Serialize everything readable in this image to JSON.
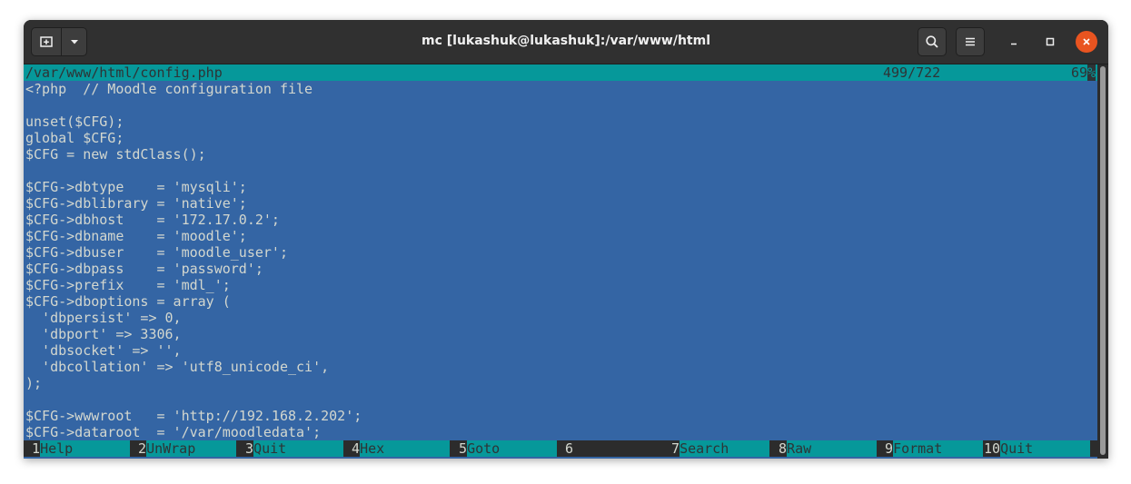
{
  "window": {
    "title": "mc [lukashuk@lukashuk]:/var/www/html"
  },
  "icons": {
    "new_tab": "new-tab-icon",
    "menu_dropdown": "chevron-down-icon",
    "search": "search-icon",
    "hamburger": "hamburger-menu-icon",
    "minimize": "minimize-icon",
    "maximize": "maximize-icon",
    "close": "close-icon"
  },
  "colors": {
    "terminal_bg": "#3465a4",
    "status_bg": "#06989a",
    "close_button": "#e95420"
  },
  "viewer": {
    "filepath": "/var/www/html/config.php",
    "line_position": "499/722",
    "percent": "69",
    "percent_sign": "%"
  },
  "code_lines": [
    "<?php  // Moodle configuration file",
    "",
    "unset($CFG);",
    "global $CFG;",
    "$CFG = new stdClass();",
    "",
    "$CFG->dbtype    = 'mysqli';",
    "$CFG->dblibrary = 'native';",
    "$CFG->dbhost    = '172.17.0.2';",
    "$CFG->dbname    = 'moodle';",
    "$CFG->dbuser    = 'moodle_user';",
    "$CFG->dbpass    = 'password';",
    "$CFG->prefix    = 'mdl_';",
    "$CFG->dboptions = array (",
    "  'dbpersist' => 0,",
    "  'dbport' => 3306,",
    "  'dbsocket' => '',",
    "  'dbcollation' => 'utf8_unicode_ci',",
    ");",
    "",
    "$CFG->wwwroot   = 'http://192.168.2.202';",
    "$CFG->dataroot  = '/var/moodledata';"
  ],
  "function_keys": [
    {
      "num": " 1",
      "label": "Help"
    },
    {
      "num": " 2",
      "label": "UnWrap"
    },
    {
      "num": " 3",
      "label": "Quit"
    },
    {
      "num": " 4",
      "label": "Hex"
    },
    {
      "num": " 5",
      "label": "Goto"
    },
    {
      "num": " 6",
      "label": ""
    },
    {
      "num": " 7",
      "label": "Search"
    },
    {
      "num": " 8",
      "label": "Raw"
    },
    {
      "num": " 9",
      "label": "Format"
    },
    {
      "num": "10",
      "label": "Quit"
    }
  ]
}
